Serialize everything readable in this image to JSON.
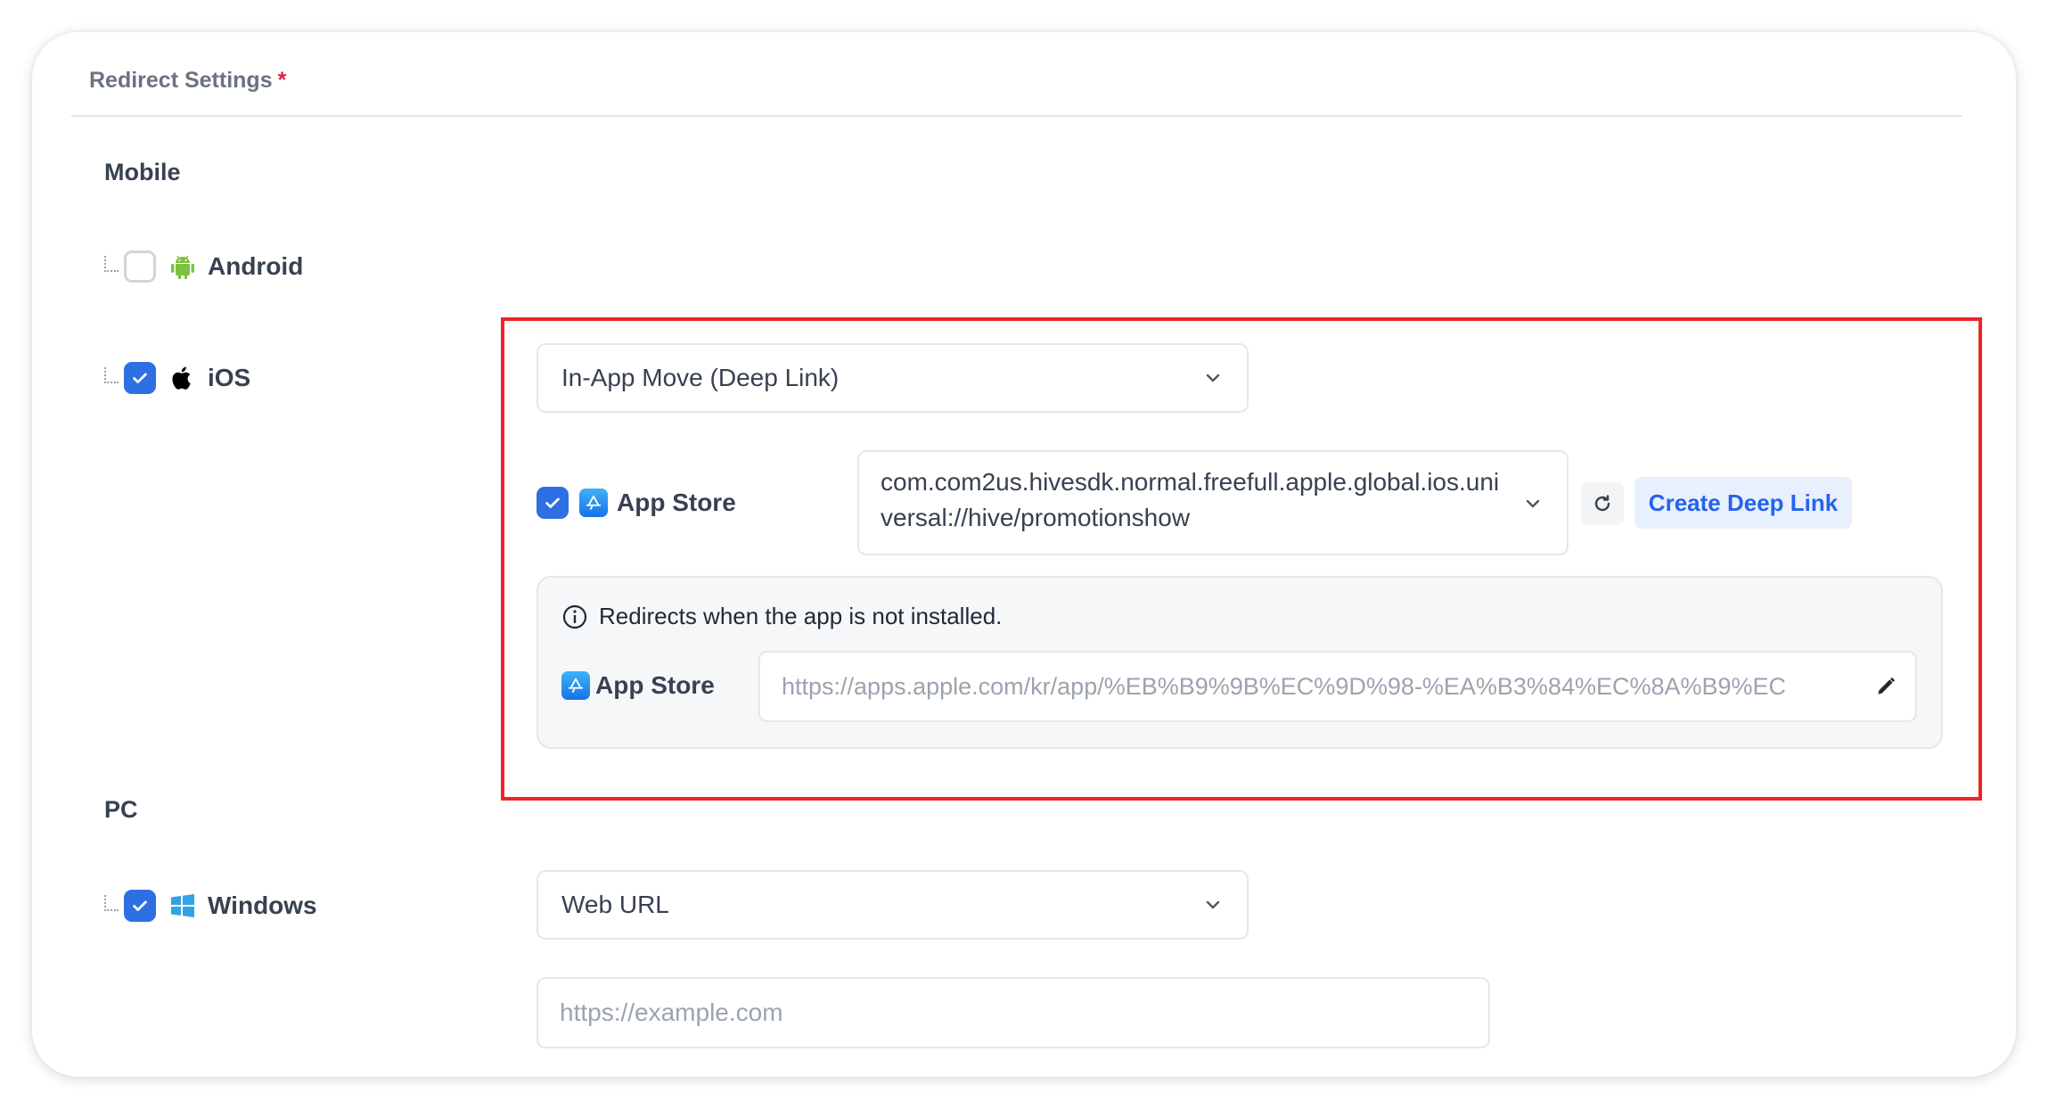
{
  "section": {
    "title": "Redirect Settings",
    "required_mark": "*"
  },
  "mobile": {
    "label": "Mobile",
    "android": {
      "label": "Android",
      "checked": false,
      "icon": "android-icon"
    },
    "ios": {
      "label": "iOS",
      "checked": true,
      "icon": "apple-icon",
      "redirect_type": "In-App Move (Deep Link)",
      "app_store": {
        "label": "App Store",
        "checked": true,
        "deep_link": "com.com2us.hivesdk.normal.freefull.apple.global.ios.universal://hive/promotionshow",
        "refresh_icon": "refresh-icon",
        "create_button": "Create Deep Link"
      },
      "not_installed": {
        "info": "Redirects when the app is not installed.",
        "store_label": "App Store",
        "url": "https://apps.apple.com/kr/app/%EB%B9%9B%EC%9D%98-%EA%B3%84%EC%8A%B9%EC"
      }
    }
  },
  "pc": {
    "label": "PC",
    "windows": {
      "label": "Windows",
      "checked": true,
      "icon": "windows-icon",
      "redirect_type": "Web URL",
      "url_placeholder": "https://example.com"
    }
  },
  "colors": {
    "accent": "#2f6fe4",
    "highlight": "#ef2328",
    "required": "#e11d48"
  }
}
